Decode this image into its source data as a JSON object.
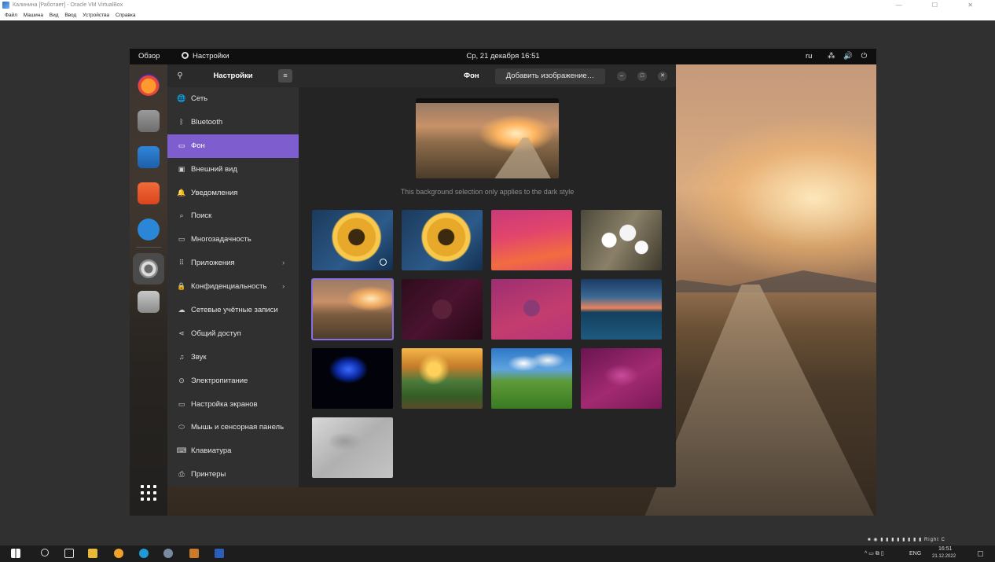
{
  "host": {
    "title": "Калинина [Работает] - Oracle VM VirtualBox",
    "menu": [
      "Файл",
      "Машина",
      "Вид",
      "Ввод",
      "Устройства",
      "Справка"
    ],
    "window_controls": "— ☐ ✕",
    "right_ctrl": "Right C"
  },
  "guest_topbar": {
    "overview": "Обзор",
    "app_name": "Настройки",
    "clock": "Ср, 21 декабря  16:51",
    "lang": "ru",
    "sys_icons": "⁂ 🔊 ⏻"
  },
  "dock": {
    "apps": [
      "firefox-icon",
      "files-icon",
      "writer-icon",
      "app-center-icon",
      "help-icon",
      "settings-icon",
      "trash-icon"
    ],
    "show_apps": "show-apps-icon"
  },
  "sidebar": {
    "title": "Настройки",
    "search_glyph": "⚲",
    "menu_glyph": "≡",
    "items": [
      {
        "label": "Сеть",
        "icon": "🌐",
        "chev": ""
      },
      {
        "label": "Bluetooth",
        "icon": "ᛒ",
        "chev": ""
      },
      {
        "label": "Фон",
        "icon": "▭",
        "chev": "",
        "active": true
      },
      {
        "label": "Внешний вид",
        "icon": "▣",
        "chev": ""
      },
      {
        "label": "Уведомления",
        "icon": "🔔",
        "chev": ""
      },
      {
        "label": "Поиск",
        "icon": "⌕",
        "chev": ""
      },
      {
        "label": "Многозадачность",
        "icon": "▭",
        "chev": ""
      },
      {
        "label": "Приложения",
        "icon": "⠿",
        "chev": "›"
      },
      {
        "label": "Конфиденциальность",
        "icon": "🔒",
        "chev": "›"
      },
      {
        "label": "Сетевые учётные записи",
        "icon": "☁",
        "chev": ""
      },
      {
        "label": "Общий доступ",
        "icon": "⋖",
        "chev": ""
      },
      {
        "label": "Звук",
        "icon": "♫",
        "chev": ""
      },
      {
        "label": "Электропитание",
        "icon": "⊙",
        "chev": ""
      },
      {
        "label": "Настройка экранов",
        "icon": "▭",
        "chev": ""
      },
      {
        "label": "Мышь и сенсорная панель",
        "icon": "⬭",
        "chev": ""
      },
      {
        "label": "Клавиатура",
        "icon": "⌨",
        "chev": ""
      },
      {
        "label": "Принтеры",
        "icon": "⎙",
        "chev": ""
      }
    ]
  },
  "content": {
    "title": "Фон",
    "add_button": "Добавить изображение…",
    "minimize_glyph": "–",
    "maximize_glyph": "□",
    "close_glyph": "✕",
    "note": "This background selection only applies to the dark style",
    "wallpapers": [
      {
        "name": "sunflower-dark",
        "current": true
      },
      {
        "name": "sunflower-light"
      },
      {
        "name": "magenta-waves"
      },
      {
        "name": "blossom"
      },
      {
        "name": "road-sunset",
        "selected": true
      },
      {
        "name": "dark-jellyfish"
      },
      {
        "name": "magenta-jellyfish"
      },
      {
        "name": "lake-sunset"
      },
      {
        "name": "blue-jellyfish"
      },
      {
        "name": "valley-sunset"
      },
      {
        "name": "green-hills"
      },
      {
        "name": "purple-jellyfish"
      },
      {
        "name": "gray-jellyfish"
      }
    ]
  },
  "taskbar": {
    "lang": "ENG",
    "time": "16:51",
    "date": "21.12.2022"
  },
  "colors": {
    "accent": "#7e5dcf",
    "sidebar_bg": "#303030",
    "content_bg": "#242424"
  }
}
